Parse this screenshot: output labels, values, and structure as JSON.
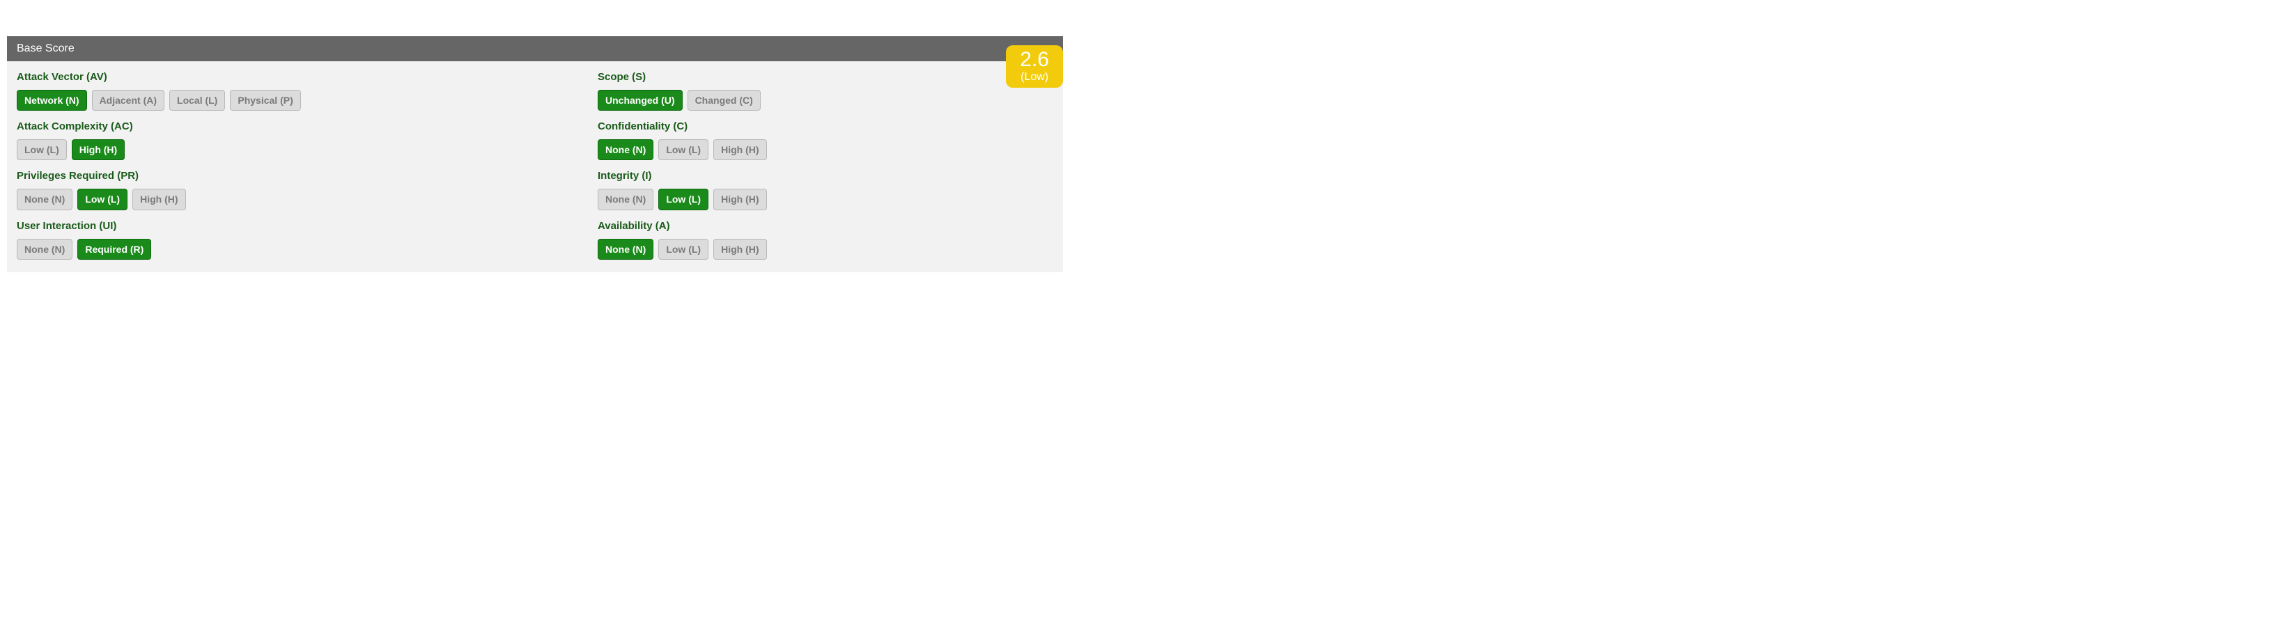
{
  "score": {
    "value": "2.6",
    "severity": "(Low)"
  },
  "panel_title": "Base Score",
  "metrics": {
    "left": [
      {
        "title": "Attack Vector (AV)",
        "options": [
          {
            "label": "Network (N)",
            "selected": true
          },
          {
            "label": "Adjacent (A)",
            "selected": false
          },
          {
            "label": "Local (L)",
            "selected": false
          },
          {
            "label": "Physical (P)",
            "selected": false
          }
        ]
      },
      {
        "title": "Attack Complexity (AC)",
        "options": [
          {
            "label": "Low (L)",
            "selected": false
          },
          {
            "label": "High (H)",
            "selected": true
          }
        ]
      },
      {
        "title": "Privileges Required (PR)",
        "options": [
          {
            "label": "None (N)",
            "selected": false
          },
          {
            "label": "Low (L)",
            "selected": true
          },
          {
            "label": "High (H)",
            "selected": false
          }
        ]
      },
      {
        "title": "User Interaction (UI)",
        "options": [
          {
            "label": "None (N)",
            "selected": false
          },
          {
            "label": "Required (R)",
            "selected": true
          }
        ]
      }
    ],
    "right": [
      {
        "title": "Scope (S)",
        "options": [
          {
            "label": "Unchanged (U)",
            "selected": true
          },
          {
            "label": "Changed (C)",
            "selected": false
          }
        ]
      },
      {
        "title": "Confidentiality (C)",
        "options": [
          {
            "label": "None (N)",
            "selected": true
          },
          {
            "label": "Low (L)",
            "selected": false
          },
          {
            "label": "High (H)",
            "selected": false
          }
        ]
      },
      {
        "title": "Integrity (I)",
        "options": [
          {
            "label": "None (N)",
            "selected": false
          },
          {
            "label": "Low (L)",
            "selected": true
          },
          {
            "label": "High (H)",
            "selected": false
          }
        ]
      },
      {
        "title": "Availability (A)",
        "options": [
          {
            "label": "None (N)",
            "selected": true
          },
          {
            "label": "Low (L)",
            "selected": false
          },
          {
            "label": "High (H)",
            "selected": false
          }
        ]
      }
    ]
  }
}
